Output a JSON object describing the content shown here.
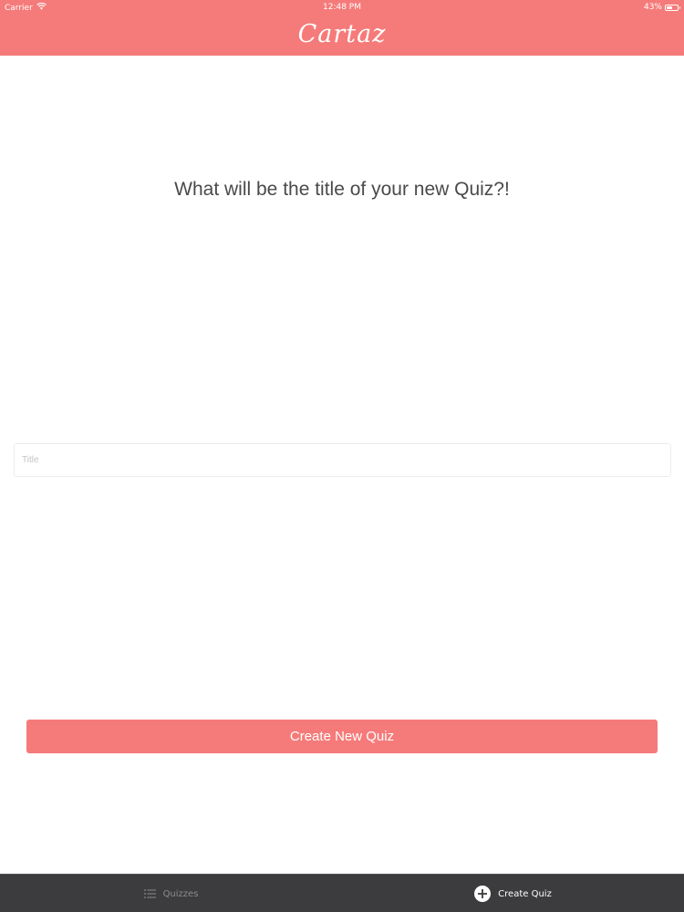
{
  "status_bar": {
    "carrier": "Carrier",
    "time": "12:48 PM",
    "battery_text": "43%",
    "battery_level": 0.43
  },
  "nav": {
    "title": "Cartaz"
  },
  "main": {
    "prompt": "What will be the title of your new Quiz?!",
    "title_input": {
      "value": "",
      "placeholder": "Title"
    },
    "create_button_label": "Create New Quiz"
  },
  "tabbar": {
    "tabs": [
      {
        "label": "Quizzes",
        "icon": "list-icon",
        "selected": false
      },
      {
        "label": "Create Quiz",
        "icon": "plus-circle-icon",
        "selected": true
      }
    ]
  },
  "colors": {
    "accent": "#f57b7a",
    "tabbar_background": "#3c3c3e",
    "text_primary": "#4a4a4a"
  }
}
